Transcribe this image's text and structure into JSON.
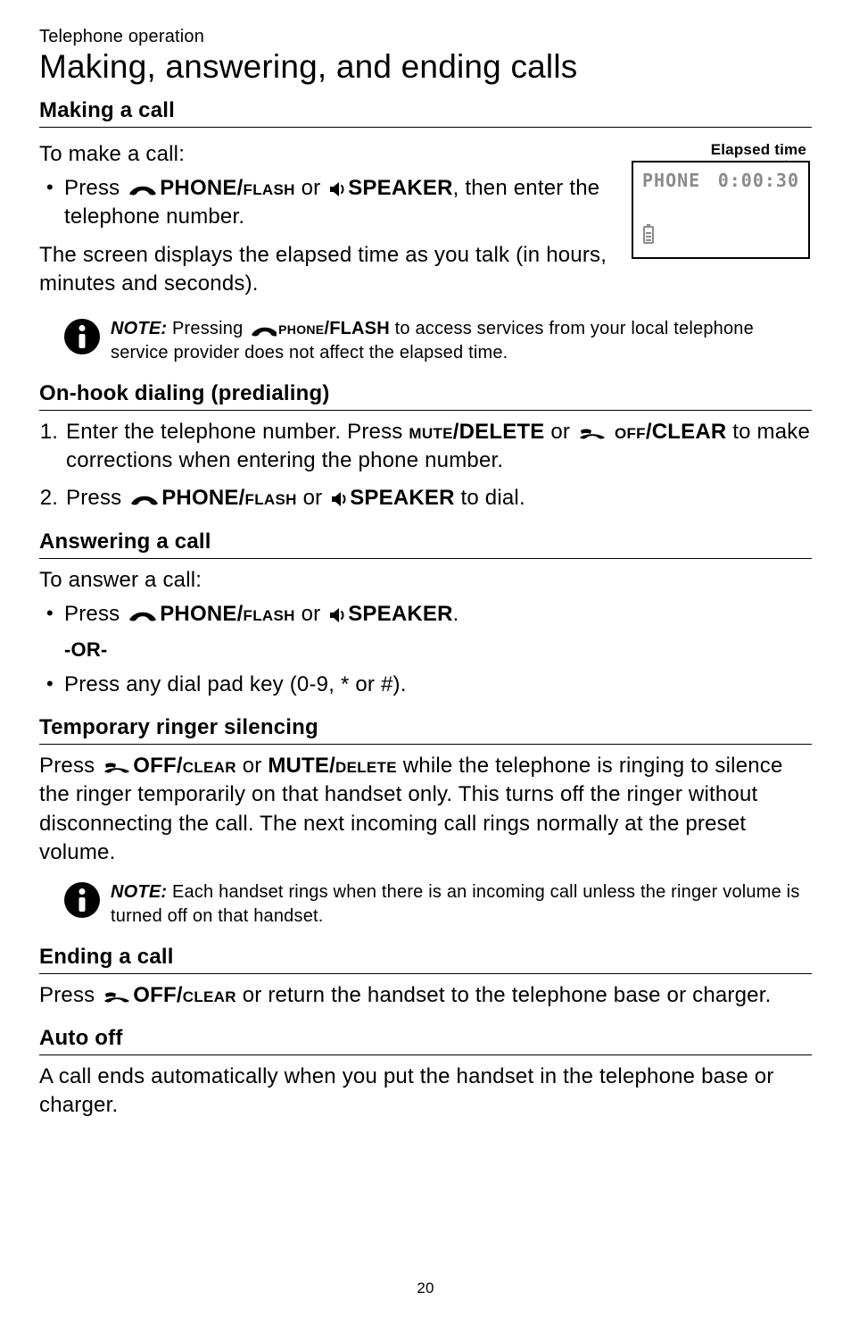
{
  "header": {
    "section_label": "Telephone operation",
    "title": "Making, answering, and ending calls"
  },
  "making_a_call": {
    "heading": "Making a call",
    "intro": "To make a call:",
    "bullet_prefix": "Press ",
    "key_phone": "PHONE",
    "key_flash_sc": "/flash",
    "or_word": " or ",
    "key_speaker": "SPEAKER",
    "bullet_suffix": ", then enter the telephone number.",
    "para2": "The screen displays the elapsed time as you talk (in hours, minutes and seconds)."
  },
  "lcd": {
    "label": "Elapsed time",
    "phone_text": "PHONE",
    "time_text": "0:00:30"
  },
  "note1": {
    "prefix": "NOTE:",
    "t1": " Pressing ",
    "key_phone_sc": "phone",
    "key_flash": "/FLASH",
    "t2": " to access services from your local telephone service provider does not affect the elapsed time."
  },
  "predial": {
    "heading": "On-hook dialing (predialing)",
    "s1_a": "Enter the telephone number. Press ",
    "mute_sc": "mute",
    "delete": "/DELETE",
    "or_word": " or ",
    "off_sc": " off",
    "clear": "/CLEAR",
    "s1_b": " to make corrections when entering the phone number.",
    "s2_a": "Press ",
    "phone": "PHONE",
    "flash_sc": "/flash",
    "speaker": "SPEAKER",
    "s2_b": " to dial."
  },
  "answering": {
    "heading": "Answering a call",
    "intro": "To answer a call:",
    "b1_a": "Press ",
    "phone": "PHONE",
    "flash_sc": "/flash",
    "or_word": " or ",
    "speaker": "SPEAKER",
    "period": ".",
    "or_block": "-OR-",
    "b2": "Press any dial pad key (0-9, * or #)."
  },
  "silencing": {
    "heading": "Temporary ringer silencing",
    "p_a": "Press ",
    "off": "OFF",
    "clear_sc": "/clear",
    "or_word": " or ",
    "mute": "MUTE/",
    "delete_sc": "delete",
    "p_b": " while the telephone is ringing to silence the ringer temporarily on that handset only. This turns off the ringer without disconnecting the call. The next incoming call rings normally at the preset volume."
  },
  "note2": {
    "prefix": "NOTE:",
    "text": " Each handset rings when there is an incoming call unless the ringer volume is turned off on that handset."
  },
  "ending": {
    "heading": "Ending a call",
    "p_a": "Press ",
    "off": "OFF",
    "clear_sc": "/clear",
    "p_b": " or return the handset to the telephone base or charger."
  },
  "autooff": {
    "heading": "Auto off",
    "p": "A call ends automatically when you put the handset in the telephone base or charger."
  },
  "page_number": "20"
}
